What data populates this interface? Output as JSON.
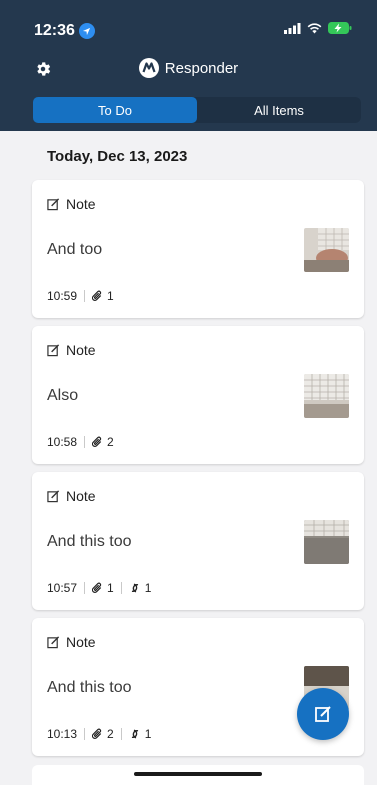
{
  "status_bar": {
    "time": "12:36",
    "icons": [
      "location-icon",
      "signal-icon",
      "wifi-icon",
      "battery-charging-icon"
    ]
  },
  "header": {
    "app_name": "Responder",
    "settings_icon": "gear-icon"
  },
  "tabs": [
    {
      "label": "To Do",
      "active": true
    },
    {
      "label": "All Items",
      "active": false
    }
  ],
  "section": {
    "date": "Today, Dec 13, 2023"
  },
  "items": [
    {
      "type": "Note",
      "title": "And too",
      "time": "10:59",
      "attachments": "1",
      "links": null
    },
    {
      "type": "Note",
      "title": "Also",
      "time": "10:58",
      "attachments": "2",
      "links": null
    },
    {
      "type": "Note",
      "title": "And this too",
      "time": "10:57",
      "attachments": "1",
      "links": "1"
    },
    {
      "type": "Note",
      "title": "And this too",
      "time": "10:13",
      "attachments": "2",
      "links": "1"
    }
  ],
  "fab": {
    "icon": "compose-icon"
  },
  "colors": {
    "header": "#24384e",
    "accent": "#1671c2",
    "background": "#f2f2f4"
  }
}
